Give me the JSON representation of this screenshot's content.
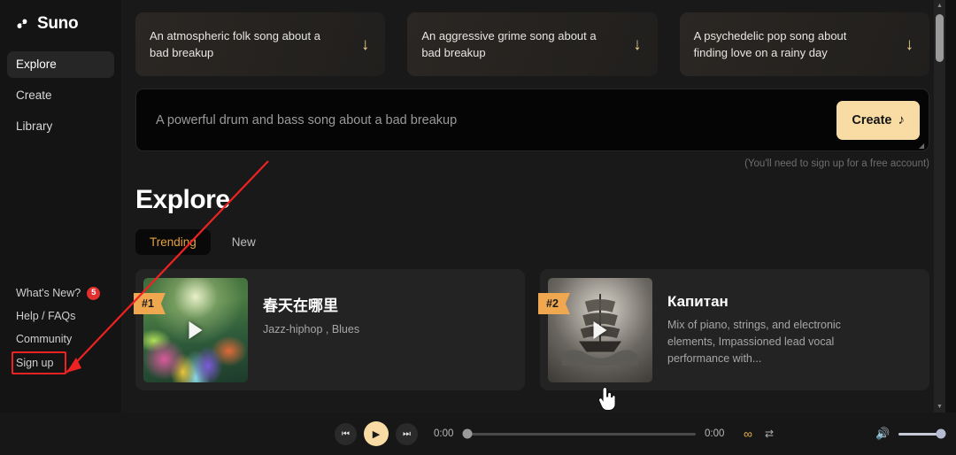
{
  "sidebar": {
    "logo": {
      "icon": "suno-logo-icon",
      "text": "Suno"
    },
    "items": [
      {
        "label": "Explore",
        "active": true
      },
      {
        "label": "Create",
        "active": false
      },
      {
        "label": "Library",
        "active": false
      }
    ],
    "bottom_links": [
      {
        "label": "What's New?",
        "badge": "5"
      },
      {
        "label": "Help / FAQs",
        "badge": ""
      },
      {
        "label": "Community",
        "badge": ""
      },
      {
        "label": "Sign up",
        "badge": ""
      }
    ]
  },
  "prompt_cards": [
    {
      "text": "An atmospheric folk song about a bad breakup",
      "icon": "down-arrow-icon"
    },
    {
      "text": "An aggressive grime song about a bad breakup",
      "icon": "down-arrow-icon"
    },
    {
      "text": "A psychedelic pop song about finding love on a rainy day",
      "icon": "down-arrow-icon"
    }
  ],
  "prompt_bar": {
    "value": "A powerful drum and bass song about a bad breakup",
    "placeholder": "A powerful drum and bass song about a bad breakup",
    "create_label": "Create",
    "create_icon": "music-note-icon",
    "note": "(You'll need to sign up for a free account)"
  },
  "explore": {
    "title": "Explore",
    "tabs": [
      {
        "label": "Trending",
        "active": true
      },
      {
        "label": "New",
        "active": false
      }
    ],
    "songs": [
      {
        "rank": "#1",
        "title": "春天在哪里",
        "subtitle": "Jazz-hiphop , Blues",
        "art": "forest-stream-artwork",
        "play_icon": "play-icon"
      },
      {
        "rank": "#2",
        "title": "Капитан",
        "subtitle": "Mix of piano, strings, and electronic elements, Impassioned lead vocal performance with...",
        "art": "sailing-ship-artwork",
        "play_icon": "play-icon"
      }
    ]
  },
  "player": {
    "prev_icon": "skip-previous-icon",
    "play_icon": "play-icon",
    "next_icon": "skip-next-icon",
    "current_time": "0:00",
    "total_time": "0:00",
    "progress_percent": 0,
    "infinity_icon": "infinity-icon",
    "repeat_icon": "repeat-icon",
    "volume_icon": "volume-icon",
    "volume_percent": 100
  },
  "scrollbar": {
    "up_icon": "scroll-up-arrow-icon",
    "down_icon": "scroll-down-arrow-icon"
  },
  "annotations": {
    "highlight_color": "#ee2222",
    "target_label": "Sign up"
  },
  "colors": {
    "accent": "#f8dca4",
    "trending": "#e3a23c",
    "rank_badge": "#f0a850",
    "badge_red": "#e03030",
    "app_bg": "#191919",
    "sidebar_bg": "#141414"
  }
}
